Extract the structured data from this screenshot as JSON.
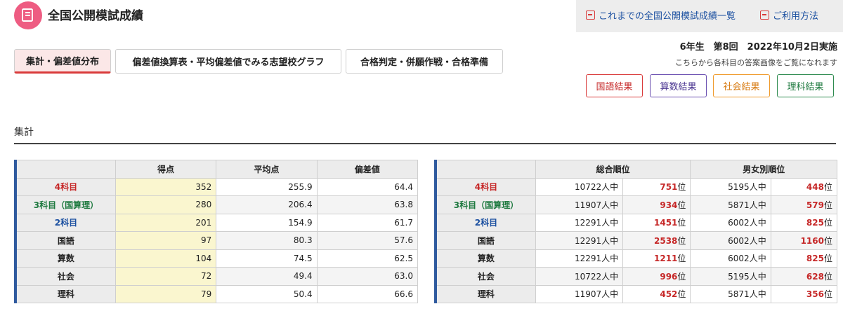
{
  "header": {
    "title": "全国公開模試成績",
    "links": [
      "これまでの全国公開模試成績一覧",
      "ご利用方法"
    ],
    "exam_info": "6年生　第8回　2022年10月2日実施",
    "note": "こちらから各科目の答案画像をご覧になれます"
  },
  "tabs": [
    {
      "label": "集計・偏差値分布",
      "active": true
    },
    {
      "label": "偏差値換算表・平均偏差値でみる志望校グラフ",
      "active": false
    },
    {
      "label": "合格判定・併願作戦・合格準備",
      "active": false
    }
  ],
  "subject_buttons": [
    "国語結果",
    "算数結果",
    "社会結果",
    "理科結果"
  ],
  "section_title": "集計",
  "score_table": {
    "headers": [
      "得点",
      "平均点",
      "偏差値"
    ],
    "rows": [
      {
        "label": "4科目",
        "score": "352",
        "avg": "255.9",
        "dev": "64.4"
      },
      {
        "label": "3科目（国算理）",
        "score": "280",
        "avg": "206.4",
        "dev": "63.8"
      },
      {
        "label": "2科目",
        "score": "201",
        "avg": "154.9",
        "dev": "61.7"
      },
      {
        "label": "国語",
        "score": "97",
        "avg": "80.3",
        "dev": "57.6"
      },
      {
        "label": "算数",
        "score": "104",
        "avg": "74.5",
        "dev": "62.5"
      },
      {
        "label": "社会",
        "score": "72",
        "avg": "49.4",
        "dev": "63.0"
      },
      {
        "label": "理科",
        "score": "79",
        "avg": "50.4",
        "dev": "66.6"
      }
    ]
  },
  "rank_table": {
    "headers": [
      "総合順位",
      "男女別順位"
    ],
    "unit_total": "人中",
    "unit_rank": "位",
    "rows": [
      {
        "label": "4科目",
        "total": "10722",
        "rank": "751",
        "g_total": "5195",
        "g_rank": "448"
      },
      {
        "label": "3科目（国算理）",
        "total": "11907",
        "rank": "934",
        "g_total": "5871",
        "g_rank": "579"
      },
      {
        "label": "2科目",
        "total": "12291",
        "rank": "1451",
        "g_total": "6002",
        "g_rank": "825"
      },
      {
        "label": "国語",
        "total": "12291",
        "rank": "2538",
        "g_total": "6002",
        "g_rank": "1160"
      },
      {
        "label": "算数",
        "total": "12291",
        "rank": "1211",
        "g_total": "6002",
        "g_rank": "825"
      },
      {
        "label": "社会",
        "total": "10722",
        "rank": "996",
        "g_total": "5195",
        "g_rank": "628"
      },
      {
        "label": "理科",
        "total": "11907",
        "rank": "452",
        "g_total": "5871",
        "g_rank": "356"
      }
    ]
  },
  "colors": {
    "accent": "#d93a3a",
    "icon_bg": "#ee5c82",
    "link": "#1a4fa0",
    "score_highlight": "#faf6cf"
  }
}
